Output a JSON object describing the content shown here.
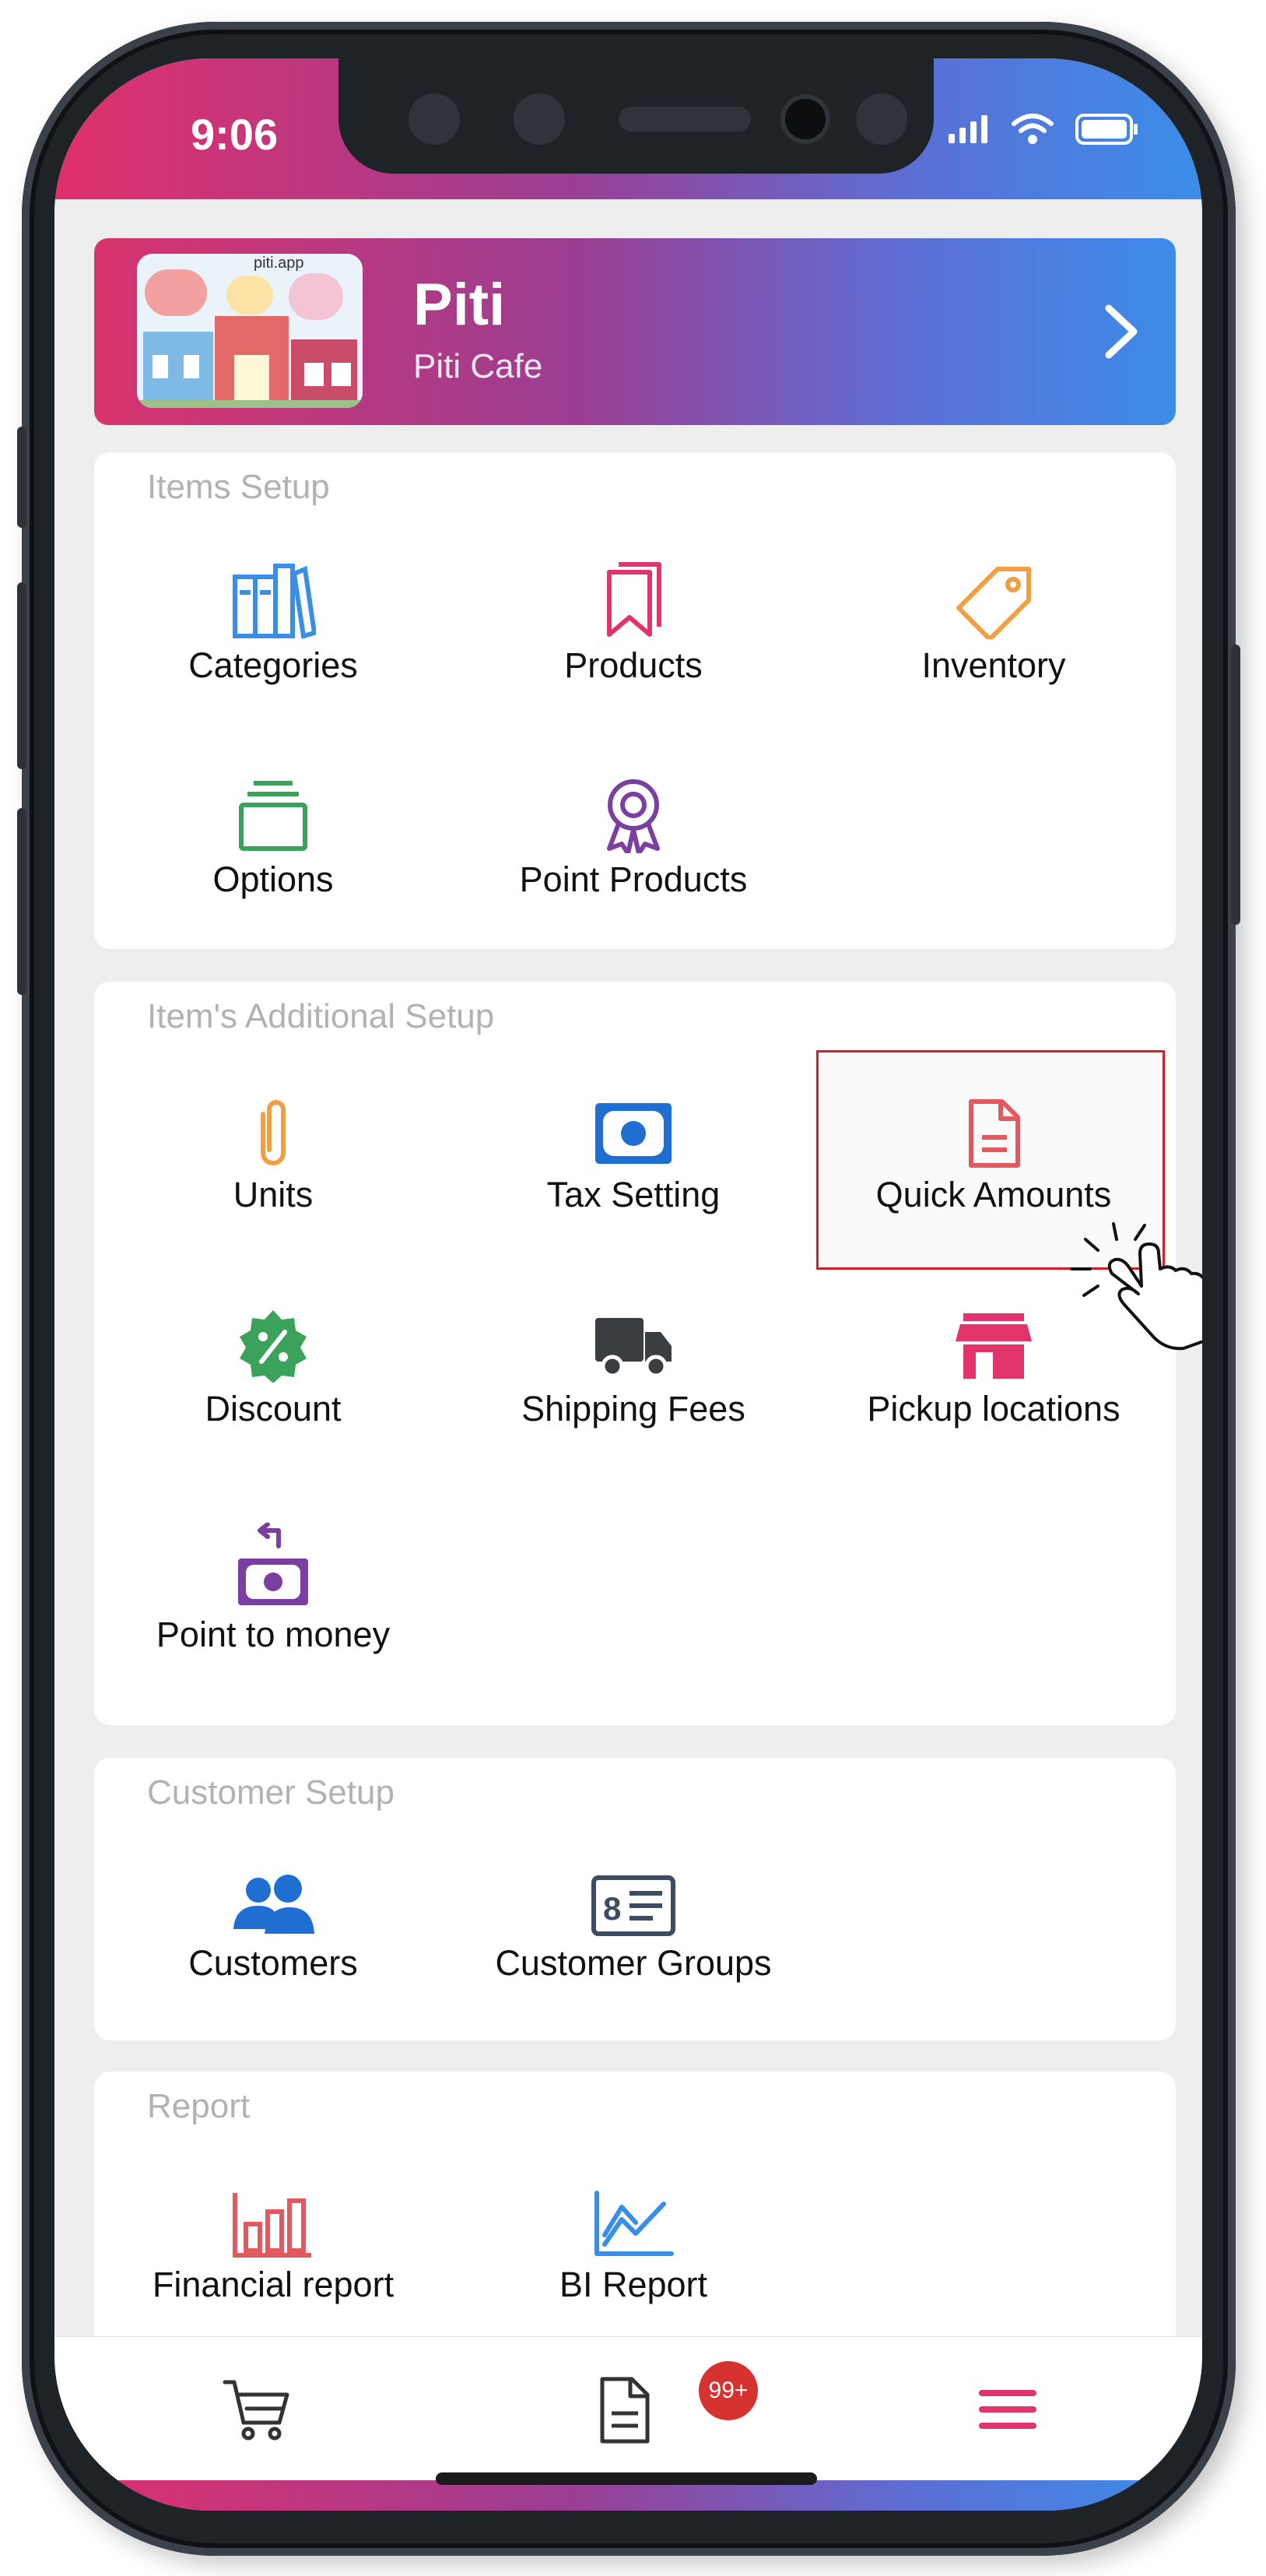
{
  "status_bar": {
    "time": "9:06"
  },
  "store": {
    "name": "Piti",
    "subtitle": "Piti Cafe",
    "logo_text": "piti.app"
  },
  "sections": [
    {
      "title": "Items Setup",
      "items": [
        {
          "label": "Categories",
          "icon": "books-icon",
          "color": "#3a8ee6"
        },
        {
          "label": "Products",
          "icon": "bookmark-icon",
          "color": "#e2336b"
        },
        {
          "label": "Inventory",
          "icon": "tag-icon",
          "color": "#f0a043"
        },
        {
          "label": "Options",
          "icon": "folder-stack-icon",
          "color": "#3aa25a"
        },
        {
          "label": "Point Products",
          "icon": "award-ribbon-icon",
          "color": "#7a3fa0"
        }
      ]
    },
    {
      "title": "Item's Additional Setup",
      "items": [
        {
          "label": "Units",
          "icon": "paperclip-icon",
          "color": "#f0a043"
        },
        {
          "label": "Tax Setting",
          "icon": "banknote-icon",
          "color": "#1e6fd1"
        },
        {
          "label": "Quick Amounts",
          "icon": "document-icon",
          "color": "#e2595f"
        },
        {
          "label": "Discount",
          "icon": "percent-badge-icon",
          "color": "#3aa25a"
        },
        {
          "label": "Shipping Fees",
          "icon": "truck-icon",
          "color": "#3a3d42"
        },
        {
          "label": "Pickup locations",
          "icon": "store-icon",
          "color": "#e2336b"
        },
        {
          "label": "Point to money",
          "icon": "money-exchange-icon",
          "color": "#7a3fa0"
        }
      ]
    },
    {
      "title": "Customer Setup",
      "items": [
        {
          "label": "Customers",
          "icon": "users-icon",
          "color": "#1e6fd1"
        },
        {
          "label": "Customer Groups",
          "icon": "id-card-icon",
          "color": "#3d4b63"
        }
      ]
    },
    {
      "title": "Report",
      "items": [
        {
          "label": "Financial report",
          "icon": "bar-chart-icon",
          "color": "#e2595f"
        },
        {
          "label": "BI Report",
          "icon": "line-chart-icon",
          "color": "#3a8ee6"
        }
      ]
    }
  ],
  "tabbar": {
    "orders_badge": "99+"
  },
  "colors": {
    "accent_pink": "#e0306b",
    "accent_blue": "#3b8de9",
    "badge_red": "#d6322f"
  }
}
